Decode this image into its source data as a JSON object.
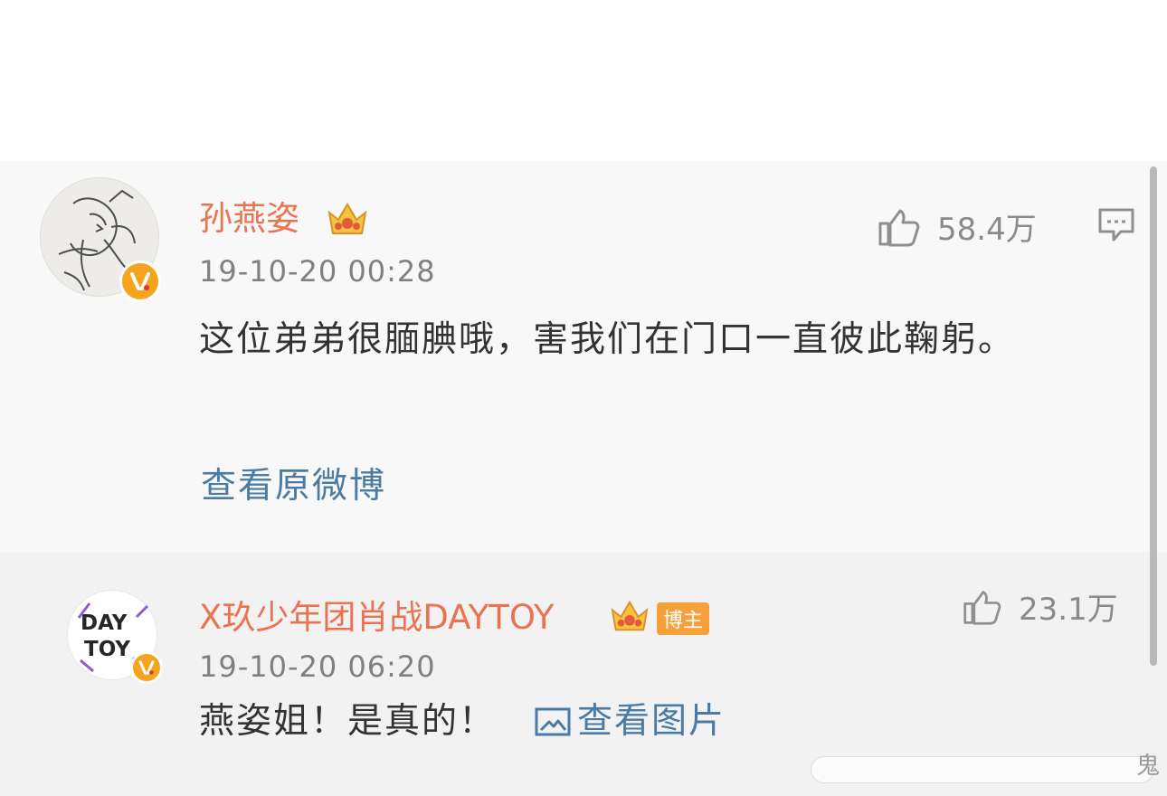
{
  "comments": [
    {
      "username": "孙燕姿",
      "timestamp": "19-10-20 00:28",
      "likes": "58.4万",
      "text": "这位弟弟很腼腆哦，害我们在门口一直彼此鞠躬。",
      "link": "查看原微博",
      "avatar_icon": "sketch-avatar-icon",
      "verified_badge_icon": "verified-v-icon",
      "crown_icon": "crown-icon"
    },
    {
      "username": "X玖少年团肖战DAYTOY",
      "badge": "博主",
      "timestamp": "19-10-20 06:20",
      "likes": "23.1万",
      "text": "燕姿姐！是真的！",
      "link": "查看图片",
      "avatar_text": "DAY TOY",
      "verified_badge_icon": "verified-v-icon",
      "crown_icon": "crown-icon"
    }
  ],
  "watermark": "鬼",
  "colors": {
    "username": "#eb7350",
    "link": "#4a7ba5",
    "verified": "#f6a31d",
    "host_badge": "#f6a03c"
  }
}
